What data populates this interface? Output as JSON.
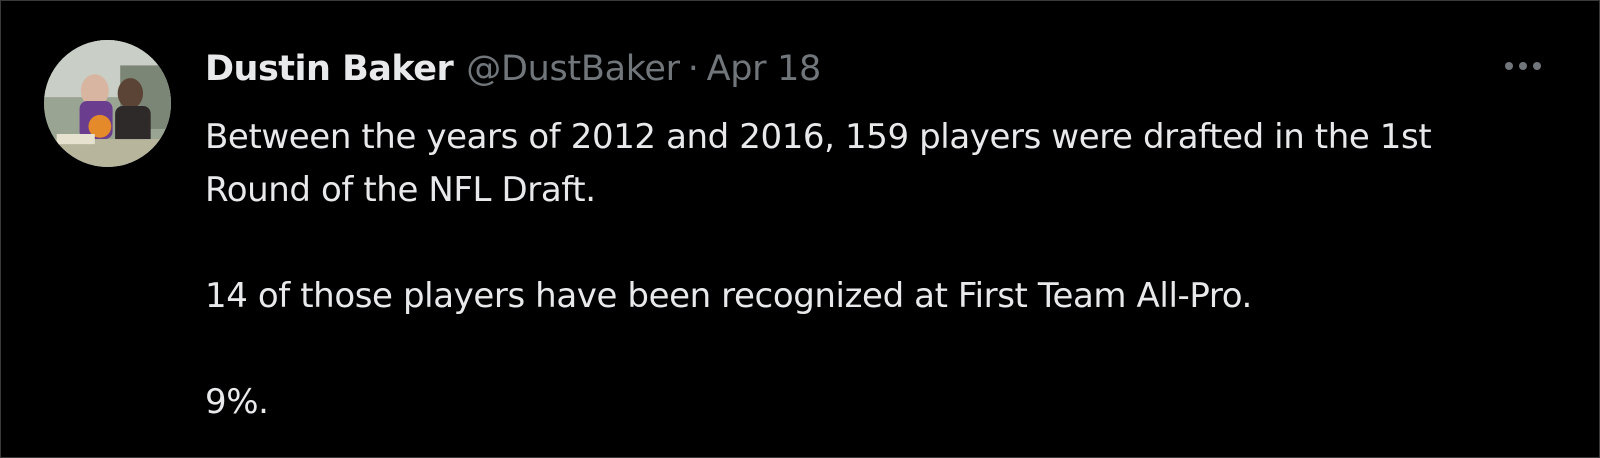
{
  "tweet": {
    "author": {
      "name": "Dustin Baker",
      "handle": "@DustBaker"
    },
    "separator": "·",
    "date": "Apr 18",
    "more_icon": "more-horizontal-icon",
    "text": {
      "line1": "Between the years of 2012 and 2016, 159 players were drafted in the 1st",
      "line2": "Round of the NFL Draft.",
      "line3": "14 of those players have been recognized at First Team All-Pro.",
      "line4": "9%."
    }
  },
  "colors": {
    "background": "#000000",
    "primary_text": "#e7e9ea",
    "secondary_text": "#71767b",
    "border": "#3a3a3a"
  }
}
